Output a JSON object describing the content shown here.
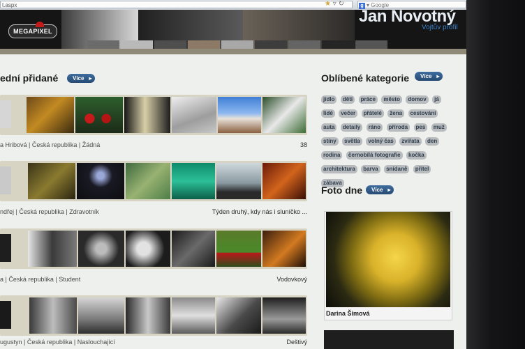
{
  "browser": {
    "url": "t.aspx",
    "search_placeholder": "Google",
    "search_engine_icon": "g-icon",
    "url_icons": [
      "star-icon",
      "dropdown-icon",
      "reload-icon"
    ]
  },
  "header": {
    "logo": "MEGAPIXEL",
    "user_name": "Jan Novotný",
    "user_sub": "Vojtův profil"
  },
  "latest": {
    "title": "ední přidané",
    "more": "Více",
    "rows": [
      {
        "meta": "a Hribová | Česká republika | Žádná",
        "right": "38"
      },
      {
        "meta": "ndřej | Česká republika | Zdravotník",
        "right": "Týden druhý, kdy nás i sluníčko ..."
      },
      {
        "meta": "a | Česká republika | Student",
        "right": "Vodovkový"
      },
      {
        "meta": "ugustyn | Česká republika | Naslouchající",
        "right": "Deštivý"
      }
    ]
  },
  "categories": {
    "title": "Oblíbené kategorie",
    "more": "Více",
    "tags": [
      "jídlo",
      "děti",
      "práce",
      "město",
      "domov",
      "já",
      "lidé",
      "večer",
      "přátelé",
      "žena",
      "cestování",
      "auta",
      "detaily",
      "ráno",
      "příroda",
      "pes",
      "muž",
      "stíny",
      "světla",
      "volný čas",
      "zvířata",
      "den",
      "rodina",
      "černobílá fotografie",
      "kočka",
      "architektura",
      "barva",
      "snídaně",
      "přítel",
      "zábava"
    ]
  },
  "photo_of_day": {
    "title": "Foto dne",
    "more": "Více",
    "author": "Darina Šimová"
  }
}
